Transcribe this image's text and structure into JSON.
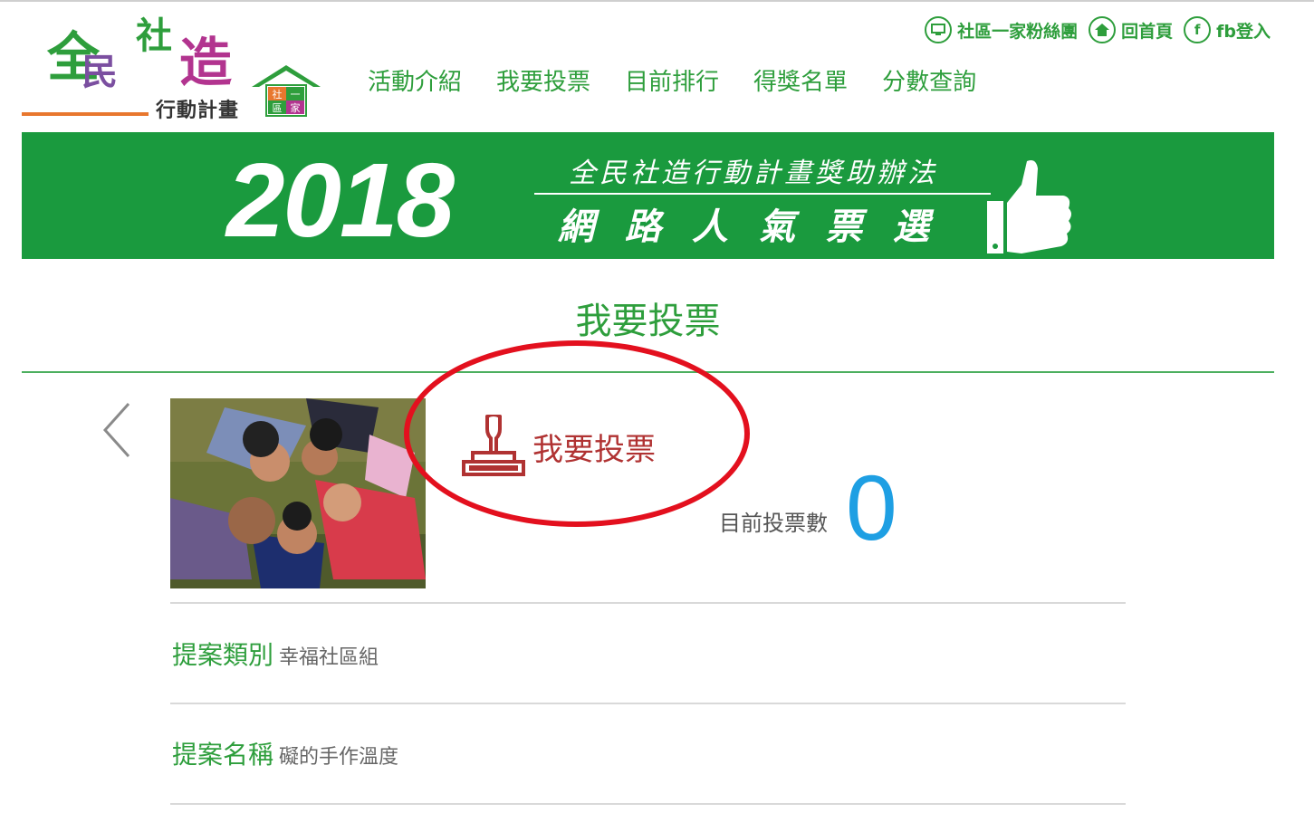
{
  "logo": {
    "chars": [
      "全",
      "民",
      "社",
      "造"
    ],
    "subtitle": "行動計畫",
    "badge": [
      "社",
      "一",
      "區",
      "家"
    ]
  },
  "toplinks": {
    "fan_label": "社區一家粉絲團",
    "home_label": "回首頁",
    "fb_label": "fb登入",
    "fb_icon_text": "f"
  },
  "nav": {
    "items": [
      "活動介紹",
      "我要投票",
      "目前排行",
      "得獎名單",
      "分數查詢"
    ]
  },
  "banner": {
    "year": "2018",
    "subtitle": "全民社造行動計畫獎助辦法",
    "headline": "網路人氣票選"
  },
  "section": {
    "title": "我要投票"
  },
  "candidate": {
    "vote_button_label": "我要投票",
    "vote_count_label": "目前投票數",
    "vote_count": "0"
  },
  "details": {
    "category_key": "提案類別",
    "category_value": "幸福社區組",
    "name_key": "提案名稱",
    "name_value": "礙的手作溫度"
  },
  "colors": {
    "brand_green": "#1a9a3e",
    "nav_green": "#2e9e3c",
    "vote_red": "#b03232",
    "highlight_oval": "#e3101e",
    "count_blue": "#1e9fe3"
  }
}
